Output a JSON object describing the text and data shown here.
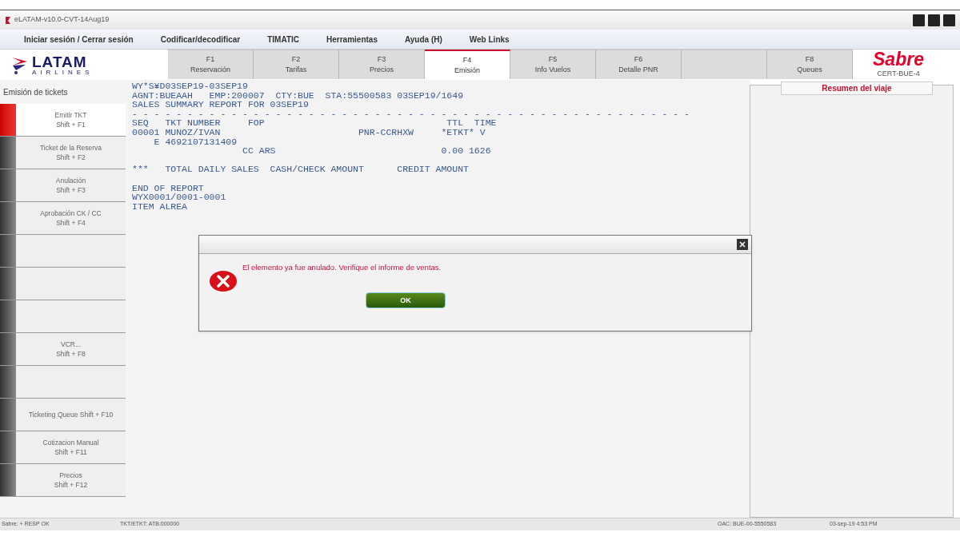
{
  "window": {
    "title": "eLATAM-v10.0-CVT-14Aug19"
  },
  "menu": [
    {
      "label": "Iniciar sesión / Cerrar sesión"
    },
    {
      "label": "Codificar/decodificar"
    },
    {
      "label": "TIMATIC"
    },
    {
      "label": "Herramientas"
    },
    {
      "label": "Ayuda (H)"
    },
    {
      "label": "Web Links"
    }
  ],
  "logo": {
    "name": "LATAM",
    "subtitle": "AIRLINES"
  },
  "tabs": [
    {
      "key": "F1",
      "label": "Reservación",
      "selected": false
    },
    {
      "key": "F2",
      "label": "Tarifas",
      "selected": false
    },
    {
      "key": "F3",
      "label": "Precios",
      "selected": false
    },
    {
      "key": "F4",
      "label": "Emisión",
      "selected": true
    },
    {
      "key": "F5",
      "label": "Info Vuelos",
      "selected": false
    },
    {
      "key": "F6",
      "label": "Detalle PNR",
      "selected": false
    },
    {
      "selected": false
    },
    {
      "key": "F8",
      "label": "Queues",
      "selected": false
    }
  ],
  "brand": {
    "name": "Sabre",
    "station": "CERT-BUE-4"
  },
  "sidebar": {
    "title": "Emisión de tickets",
    "items": [
      {
        "label": "Emitir TKT",
        "shortcut": "Shift + F1",
        "selected": true
      },
      {
        "label": "Ticket de la Reserva",
        "shortcut": "Shift + F2",
        "selected": false
      },
      {
        "label": "Anulación",
        "shortcut": "Shift + F3",
        "selected": false
      },
      {
        "label": "Aprobación CK / CC",
        "shortcut": "Shift + F4",
        "selected": false
      },
      {
        "selected": false
      },
      {
        "selected": false
      },
      {
        "selected": false
      },
      {
        "label": "VCR...",
        "shortcut": "Shift + F8",
        "selected": false
      },
      {
        "selected": false
      },
      {
        "label": "Ticketing Queue Shift + F10",
        "selected": false
      },
      {
        "label": "Cotizacion Manual",
        "shortcut": "Shift + F11",
        "selected": false
      },
      {
        "label": "Precios",
        "shortcut": "Shift + F12",
        "selected": false
      }
    ]
  },
  "terminal": {
    "blocks": [
      [
        "WY*S¥D03SEP19-03SEP19",
        "AGNT:BUEAAH   EMP:200007  CTY:BUE  STA:55500583 03SEP19/1649",
        "SALES SUMMARY REPORT FOR 03SEP19",
        "- - - - - - - - - - - - - - - - - - - - - - - - - - - - - - - - - - - - - - - - - - - - - - - - - - -",
        "SEQ   TKT NUMBER     FOP                                 TTL  TIME",
        "00001 MUNOZ/IVAN                         PNR-CCRHXW     *ETKT* V",
        "    E 4692107131409",
        "                    CC ARS                              0.00 1626"
      ],
      [
        "***   TOTAL DAILY SALES  CASH/CHECK AMOUNT      CREDIT AMOUNT"
      ],
      [
        "END OF REPORT",
        "WYX0001/0001-0001",
        "ITEM ALREA"
      ]
    ]
  },
  "summary_panel": {
    "title": "Resumen del viaje"
  },
  "dialog": {
    "message": "El elemento ya fue anulado. Verifique el informe de ventas.",
    "button": "OK"
  },
  "status_bar": {
    "left": "Sabre: + RESP OK",
    "middle": "TKT/ETKT: ATB:000000",
    "right_1": "OAC: BUE-00-5550583",
    "right_2": "03-sep-19 4:53 PM"
  }
}
